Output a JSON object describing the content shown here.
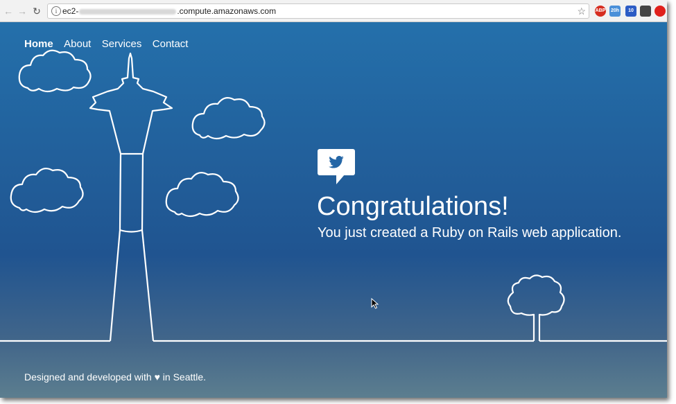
{
  "browser": {
    "url_prefix": "ec2-",
    "url_suffix": ".compute.amazonaws.com",
    "info_glyph": "i",
    "star_glyph": "☆",
    "back_glyph": "←",
    "forward_glyph": "→",
    "reload_glyph": "↻",
    "extensions": [
      {
        "name": "abp",
        "label": "ABP",
        "color": "#d62d20"
      },
      {
        "name": "calendar",
        "label": "20h",
        "color": "#4a90d9"
      },
      {
        "name": "home",
        "label": "10",
        "color": "#2c5cc5"
      },
      {
        "name": "glasses",
        "label": "",
        "color": "#444444"
      },
      {
        "name": "opera",
        "label": "",
        "color": "#e0201b"
      }
    ]
  },
  "nav": {
    "items": [
      "Home",
      "About",
      "Services",
      "Contact"
    ],
    "active": "Home"
  },
  "hero": {
    "headline": "Congratulations!",
    "subline": "You just created a Ruby on Rails web application."
  },
  "footer": {
    "text": "Designed and developed with ♥ in Seattle."
  },
  "colors": {
    "page_top": "#2470ab",
    "page_mid": "#205490",
    "page_bottom": "#5c7e8f",
    "bubble": "#ffffff",
    "twitter_icon": "#2466a6"
  }
}
